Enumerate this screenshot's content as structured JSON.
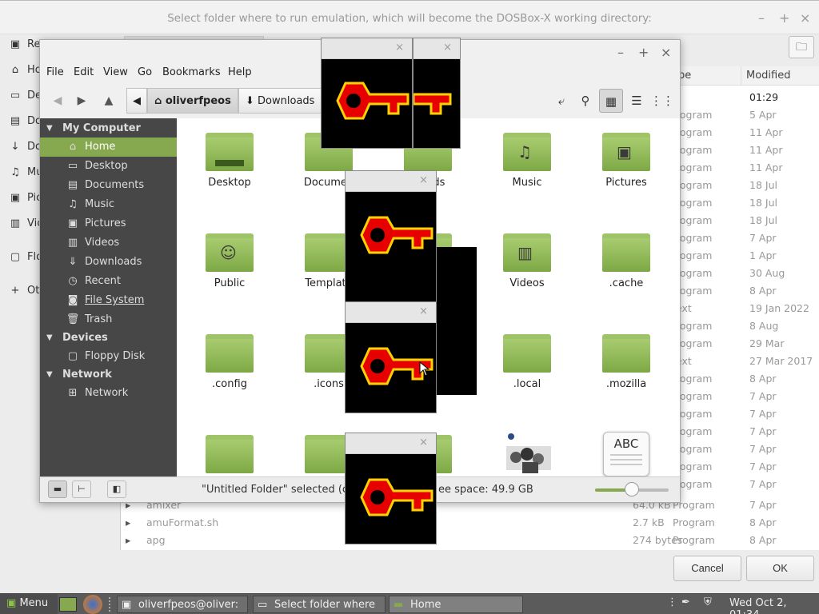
{
  "dialog": {
    "title": "Select folder where to run emulation, which will become the DOSBox-X working directory:",
    "wc_min": "–",
    "wc_max": "+",
    "wc_close": "×",
    "sidebar": [
      "Re",
      "Ho",
      "De",
      "Do",
      "Do",
      "Mu",
      "Pic",
      "Vic",
      "Flo",
      "Ot"
    ],
    "col_type": "pe",
    "col_modified": "Modified",
    "rows": [
      {
        "type": "",
        "modified": "01:29"
      },
      {
        "type": "rogram",
        "modified": "5 Apr"
      },
      {
        "type": "rogram",
        "modified": "11 Apr"
      },
      {
        "type": "rogram",
        "modified": "11 Apr"
      },
      {
        "type": "rogram",
        "modified": "11 Apr"
      },
      {
        "type": "rogram",
        "modified": "18 Jul"
      },
      {
        "type": "rogram",
        "modified": "18 Jul"
      },
      {
        "type": "rogram",
        "modified": "18 Jul"
      },
      {
        "type": "rogram",
        "modified": "7 Apr"
      },
      {
        "type": "rogram",
        "modified": "1 Apr"
      },
      {
        "type": "rogram",
        "modified": "30 Aug"
      },
      {
        "type": "rogram",
        "modified": "8 Apr"
      },
      {
        "type": "ext",
        "modified": "19 Jan 2022"
      },
      {
        "type": "rogram",
        "modified": "8 Aug"
      },
      {
        "type": "rogram",
        "modified": "29 Mar"
      },
      {
        "type": "ext",
        "modified": "27 Mar 2017"
      },
      {
        "type": "rogram",
        "modified": "8 Apr"
      },
      {
        "type": "rogram",
        "modified": "7 Apr"
      },
      {
        "type": "rogram",
        "modified": "7 Apr"
      },
      {
        "type": "rogram",
        "modified": "7 Apr"
      },
      {
        "type": "rogram",
        "modified": "7 Apr"
      },
      {
        "type": "rogram",
        "modified": "7 Apr"
      },
      {
        "type": "rogram",
        "modified": "7 Apr"
      }
    ],
    "bottom_rows": [
      {
        "name": "amixer",
        "size": "64.0 kB",
        "type": "Program",
        "modified": "7 Apr"
      },
      {
        "name": "amuFormat.sh",
        "size": "2.7 kB",
        "type": "Program",
        "modified": "8 Apr"
      },
      {
        "name": "apg",
        "size": "274 bytes",
        "type": "Program",
        "modified": "8 Apr"
      }
    ],
    "cancel": "Cancel",
    "ok": "OK"
  },
  "nemo": {
    "wc_min": "–",
    "wc_max": "+",
    "wc_close": "×",
    "menu": [
      "File",
      "Edit",
      "View",
      "Go",
      "Bookmarks",
      "Help"
    ],
    "crumb_home": "oliverfpeos",
    "crumb_downloads": "Downloads",
    "sections": {
      "computer": "My Computer",
      "devices": "Devices",
      "network": "Network"
    },
    "places": [
      "Home",
      "Desktop",
      "Documents",
      "Music",
      "Pictures",
      "Videos",
      "Downloads",
      "Recent",
      "File System",
      "Trash"
    ],
    "devices": [
      "Floppy Disk"
    ],
    "network": [
      "Network"
    ],
    "folders": [
      {
        "label": "Desktop"
      },
      {
        "label": "Documen"
      },
      {
        "label": "nloads"
      },
      {
        "label": "Music"
      },
      {
        "label": "Pictures"
      },
      {
        "label": "Public"
      },
      {
        "label": "Template"
      },
      {
        "label": ""
      },
      {
        "label": "Videos"
      },
      {
        "label": ".cache"
      },
      {
        "label": ".config"
      },
      {
        "label": ".icons"
      },
      {
        "label": ""
      },
      {
        "label": ".local"
      },
      {
        "label": ".mozilla"
      }
    ],
    "abc_label": "ABC",
    "status_text": "\"Untitled Folder\" selected (con",
    "free_space": "ee space: 49.9 GB"
  },
  "keys": {
    "close": "×"
  },
  "taskbar": {
    "menu": "Menu",
    "terminal": "oliverfpeos@oliver: ~",
    "select": "Select folder where ...",
    "home": "Home",
    "clock": "Wed Oct  2, 01:34"
  },
  "colors": {
    "accent": "#86a84e",
    "sidebar_bg": "#474747",
    "key_red": "#e60000",
    "key_yellow": "#ffd200"
  }
}
